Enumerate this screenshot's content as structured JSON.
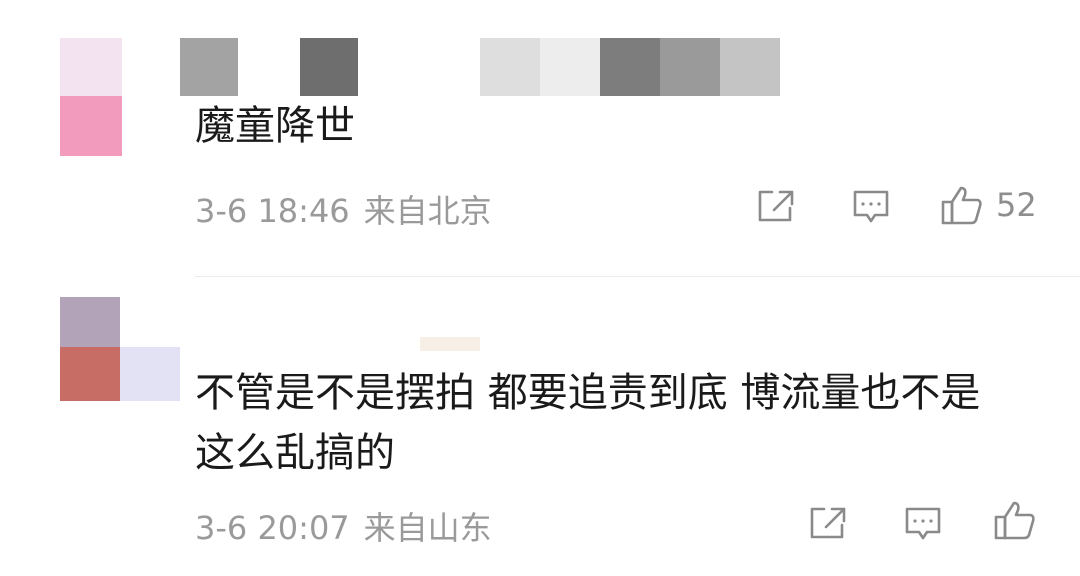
{
  "comments": [
    {
      "text": "魔童降世",
      "time": "3-6 18:46",
      "location": "来自北京",
      "likes": "52",
      "icons": {
        "share": "share-icon",
        "reply": "comment-icon",
        "like": "thumbs-up-icon"
      }
    },
    {
      "text": "不管是不是摆拍 都要追责到底 博流量也不是\n这么乱搞的",
      "time": "3-6 20:07",
      "location": "来自山东",
      "likes": "",
      "icons": {
        "share": "share-icon",
        "reply": "comment-icon",
        "like": "thumbs-up-icon"
      }
    }
  ],
  "colors": {
    "text": "#1a1a1a",
    "meta": "#9a9a9a",
    "icon": "#8a8a8a",
    "divider": "#ececec"
  }
}
